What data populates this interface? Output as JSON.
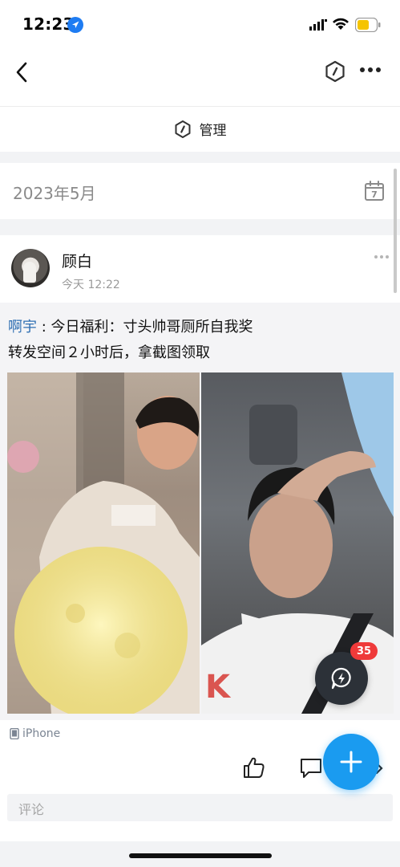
{
  "status_bar": {
    "time": "12:23"
  },
  "nav": {
    "back_icon": "chevron-left-icon",
    "right_icons": [
      "hexagon-shield-icon",
      "more-horizontal-icon"
    ]
  },
  "manage": {
    "label": "管理"
  },
  "timeline": {
    "month": "2023年5月",
    "calendar_day": "7"
  },
  "post": {
    "author": "顾白",
    "time": "今天 12:22",
    "quoted_author": "啊宇",
    "quoted_text_line1": " : 今日福利：寸头帅哥厕所自我奖",
    "quoted_text_line2": "转发空间２小时后，拿截图领取",
    "device": "iPhone",
    "comment_placeholder": "评论"
  },
  "floating": {
    "badge_count": "35"
  },
  "colors": {
    "accent_blue": "#1a9bf0",
    "link_blue": "#2f6fb3",
    "badge_red": "#ef3a3a"
  }
}
